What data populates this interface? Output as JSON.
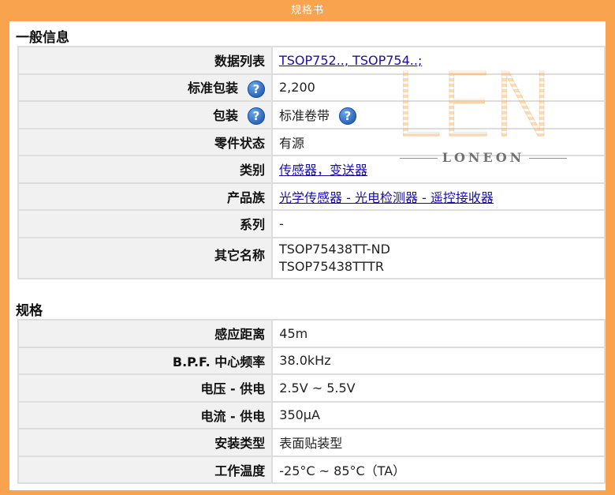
{
  "header": {
    "title": "规格书"
  },
  "general": {
    "title": "一般信息",
    "rows": [
      {
        "label": "数据列表",
        "value": "TSOP752.., TSOP754..;",
        "link": true
      },
      {
        "label": "标准包装",
        "value": "2,200",
        "help": true
      },
      {
        "label": "包装",
        "value": "标准卷带",
        "help": true,
        "value_help": true
      },
      {
        "label": "零件状态",
        "value": "有源"
      },
      {
        "label": "类别",
        "value": "传感器，变送器",
        "link": true
      },
      {
        "label": "产品族",
        "value": "光学传感器 - 光电检测器 - 遥控接收器",
        "link": true
      },
      {
        "label": "系列",
        "value": "-"
      },
      {
        "label": "其它名称",
        "value": "TSOP75438TT-ND",
        "value2": "TSOP75438TTTR"
      }
    ]
  },
  "specs": {
    "title": "规格",
    "rows": [
      {
        "label": "感应距离",
        "value": "45m"
      },
      {
        "label": "B.P.F. 中心频率",
        "value": "38.0kHz"
      },
      {
        "label": "电压 - 供电",
        "value": "2.5V ~ 5.5V"
      },
      {
        "label": "电流 - 供电",
        "value": "350µA"
      },
      {
        "label": "安装类型",
        "value": "表面贴装型"
      },
      {
        "label": "工作温度",
        "value": "-25°C ~ 85°C（TA）"
      }
    ]
  },
  "watermark": {
    "letters": "LEN",
    "brand": "LONEON"
  },
  "icons": {
    "help": "question-help-icon"
  },
  "colors": {
    "frame": "#f9a34e",
    "label_bg": "#f1f1f1",
    "link": "#1a0dab"
  }
}
